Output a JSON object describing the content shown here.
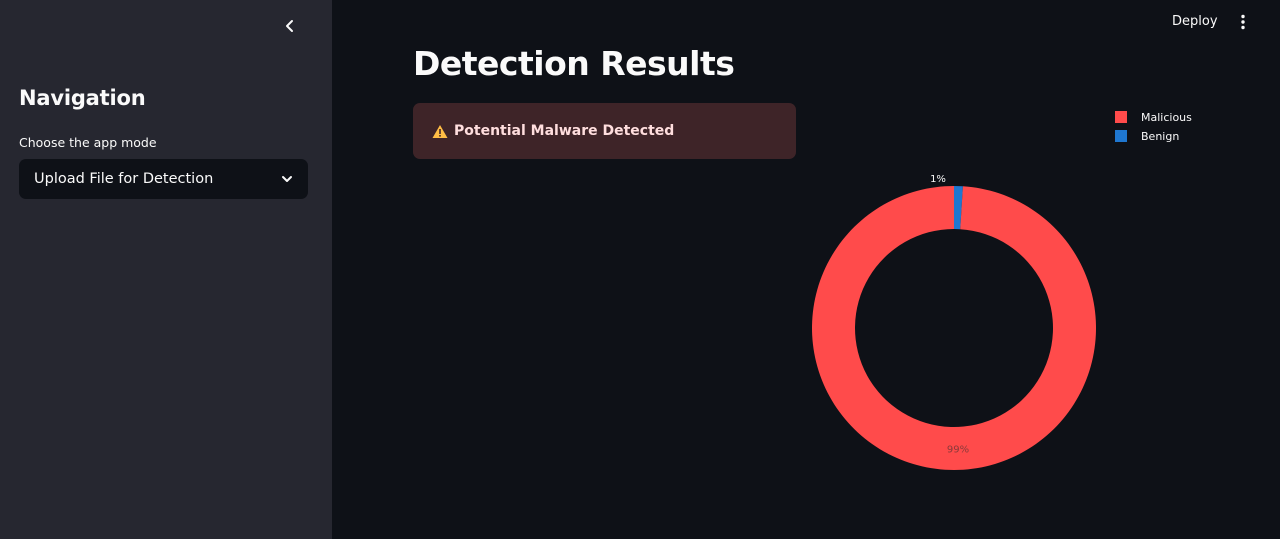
{
  "sidebar": {
    "title": "Navigation",
    "select_label": "Choose the app mode",
    "select_value": "Upload File for Detection"
  },
  "header": {
    "deploy_label": "Deploy"
  },
  "main": {
    "title": "Detection Results",
    "alert_text": "Potential Malware Detected"
  },
  "icons": {
    "collapse": "chevron-left-icon",
    "select": "chevron-down-icon",
    "menu": "more-vertical-icon",
    "warning": "warning-icon"
  },
  "colors": {
    "background": "#0e1117",
    "sidebar": "#262730",
    "alert_background": "#3e2428",
    "malicious": "#ff4b4b",
    "benign": "#1f77d0"
  },
  "chart_data": {
    "type": "pie",
    "hole": true,
    "categories": [
      "Malicious",
      "Benign"
    ],
    "values": [
      99,
      1
    ],
    "labels": [
      "99%",
      "1%"
    ],
    "colors": [
      "#ff4b4b",
      "#1f77d0"
    ],
    "legend": "top-right"
  }
}
